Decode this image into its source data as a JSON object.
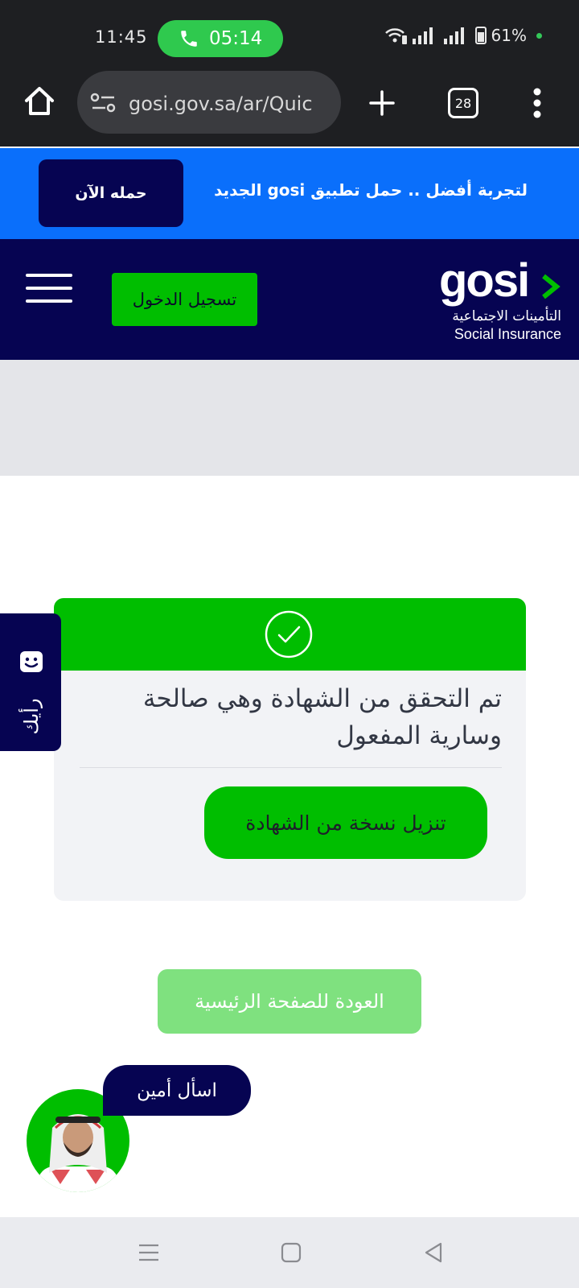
{
  "status_bar": {
    "time": "11:45",
    "call_duration": "05:14",
    "battery": "61%",
    "colors": {
      "call_pill": "#2fc94e",
      "background": "#1e1f22"
    }
  },
  "browser": {
    "url": "gosi.gov.sa/ar/Quic",
    "tab_count": "28",
    "icons": [
      "home-icon",
      "site-settings-icon",
      "new-tab-icon",
      "tab-switcher-icon",
      "more-options-icon"
    ]
  },
  "promo_banner": {
    "text": "لتجربة أفضل .. حمل تطبيق gosi الجديد",
    "button_label": "حمله الآن"
  },
  "header": {
    "logo_text": "gosi",
    "logo_ar": "التأمينات الاجتماعية",
    "logo_en": "Social Insurance",
    "login_label": "تسجيل الدخول",
    "colors": {
      "navy": "#060452",
      "green": "#00be00",
      "promo_blue": "#0a6ffb"
    }
  },
  "result": {
    "message": "تم التحقق من الشهادة وهي صالحة وسارية المفعول",
    "download_label": "تنزيل نسخة من الشهادة",
    "home_label": "العودة للصفحة الرئيسية"
  },
  "feedback": {
    "label": "رأيك"
  },
  "chat": {
    "bubble_label": "اسأل أمين"
  }
}
